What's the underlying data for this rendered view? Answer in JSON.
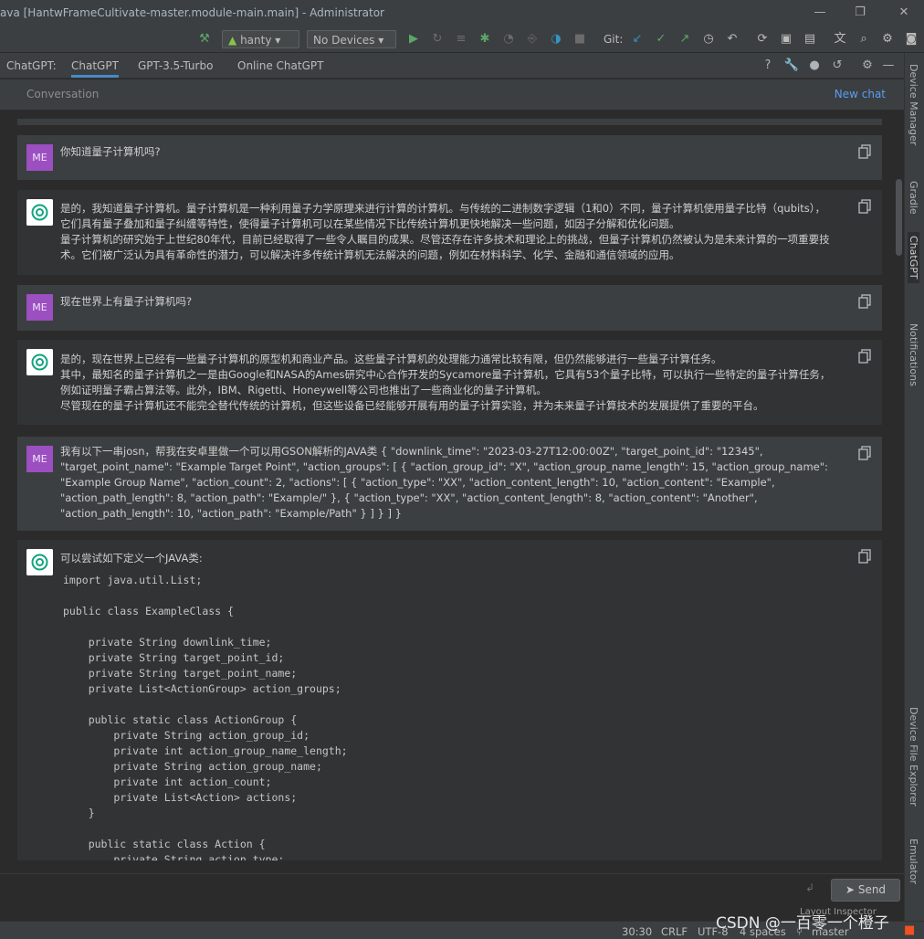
{
  "window": {
    "title": "ava [HantwFrameCultivate-master.module-main.main] - Administrator",
    "minimize": "—",
    "maximize": "❐",
    "close": "✕"
  },
  "toolbar": {
    "run_config": "hanty",
    "device": "No Devices",
    "git_label": "Git:"
  },
  "chatgpt_tabs": {
    "prefix": "ChatGPT:",
    "tabs": [
      "ChatGPT",
      "GPT-3.5-Turbo",
      "Online ChatGPT"
    ]
  },
  "conversation": {
    "title": "Conversation",
    "new_chat": "New chat"
  },
  "right_stripe": [
    "Device Manager",
    "Gradle",
    "ChatGPT",
    "Notifications",
    "Device File Explorer",
    "Emulator"
  ],
  "messages": [
    {
      "role": "user",
      "avatar": "ME",
      "text": "你知道量子计算机吗?"
    },
    {
      "role": "assistant",
      "text": "是的，我知道量子计算机。量子计算机是一种利用量子力学原理来进行计算的计算机。与传统的二进制数字逻辑（1和0）不同，量子计算机使用量子比特（qubits），它们具有量子叠加和量子纠缠等特性，使得量子计算机可以在某些情况下比传统计算机更快地解决一些问题，如因子分解和优化问题。\n量子计算机的研究始于上世纪80年代，目前已经取得了一些令人瞩目的成果。尽管还存在许多技术和理论上的挑战，但量子计算机仍然被认为是未来计算的一项重要技术。它们被广泛认为具有革命性的潜力，可以解决许多传统计算机无法解决的问题，例如在材料科学、化学、金融和通信领域的应用。"
    },
    {
      "role": "user",
      "avatar": "ME",
      "text": "现在世界上有量子计算机吗?"
    },
    {
      "role": "assistant",
      "text": "是的，现在世界上已经有一些量子计算机的原型机和商业产品。这些量子计算机的处理能力通常比较有限，但仍然能够进行一些量子计算任务。\n其中，最知名的量子计算机之一是由Google和NASA的Ames研究中心合作开发的Sycamore量子计算机，它具有53个量子比特，可以执行一些特定的量子计算任务，例如证明量子霸占算法等。此外，IBM、Rigetti、Honeywell等公司也推出了一些商业化的量子计算机。\n尽管现在的量子计算机还不能完全替代传统的计算机，但这些设备已经能够开展有用的量子计算实验，并为未来量子计算技术的发展提供了重要的平台。"
    },
    {
      "role": "user",
      "avatar": "ME",
      "text": "我有以下一串josn，帮我在安卓里做一个可以用GSON解析的JAVA类 { \"downlink_time\": \"2023-03-27T12:00:00Z\", \"target_point_id\": \"12345\", \"target_point_name\": \"Example Target Point\", \"action_groups\": [ { \"action_group_id\": \"X\", \"action_group_name_length\": 15, \"action_group_name\": \"Example Group Name\", \"action_count\": 2, \"actions\": [ { \"action_type\": \"XX\", \"action_content_length\": 10, \"action_content\": \"Example\", \"action_path_length\": 8, \"action_path\": \"Example/\" }, { \"action_type\": \"XX\", \"action_content_length\": 8, \"action_content\": \"Another\", \"action_path_length\": 10, \"action_path\": \"Example/Path\" } ] } ] }"
    },
    {
      "role": "assistant",
      "text": "可以尝试如下定义一个JAVA类:",
      "code": "import java.util.List;\n\npublic class ExampleClass {\n\n    private String downlink_time;\n    private String target_point_id;\n    private String target_point_name;\n    private List<ActionGroup> action_groups;\n\n    public static class ActionGroup {\n        private String action_group_id;\n        private int action_group_name_length;\n        private String action_group_name;\n        private int action_count;\n        private List<Action> actions;\n    }\n\n    public static class Action {\n        private String action_type;"
    }
  ],
  "input": {
    "placeholder": "",
    "send_label": "Send"
  },
  "statusbar": {
    "position": "30:30",
    "line_sep": "CRLF",
    "encoding": "UTF-8",
    "indent": "4 spaces",
    "branch": "master"
  },
  "watermark": {
    "text": "CSDN @一百零一个橙子",
    "overlay": "Layout Inspector"
  }
}
